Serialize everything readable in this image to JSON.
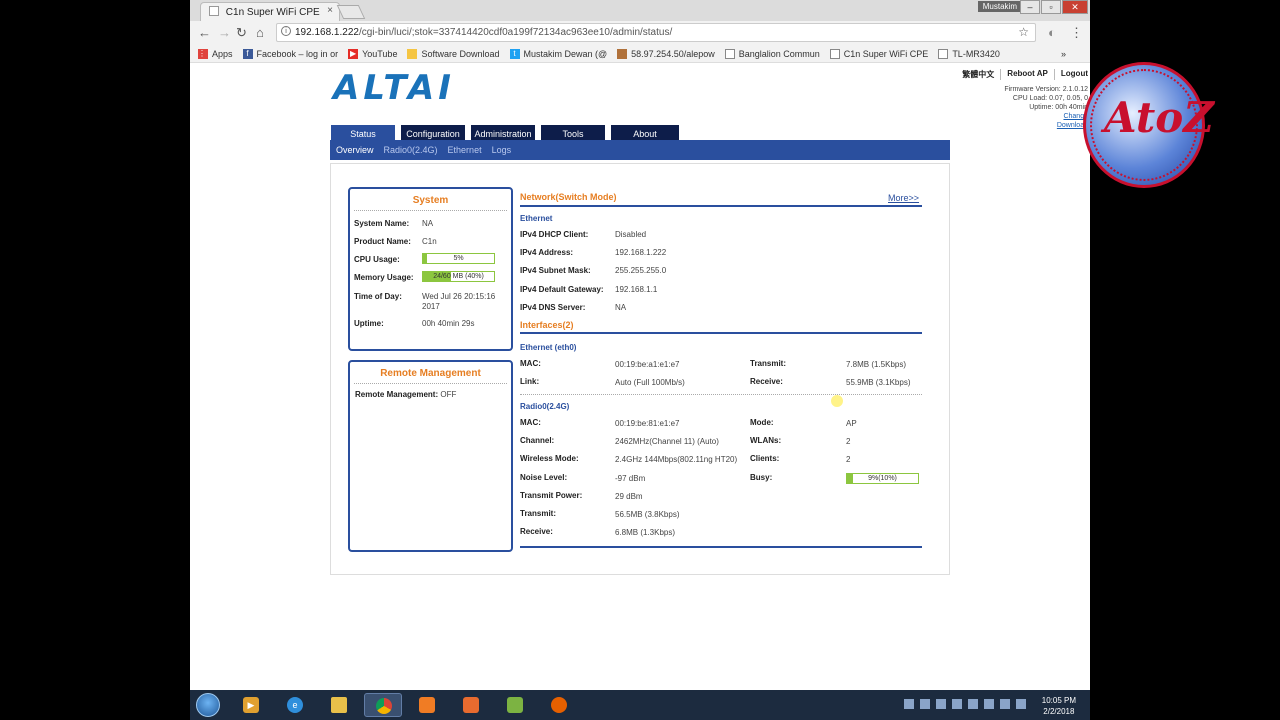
{
  "browser": {
    "tab_title": "C1n Super WiFi CPE",
    "close_glyph": "×",
    "window_user": "Mustakim",
    "url_host": "192.168.1.222",
    "url_path": "/cgi-bin/luci/;stok=337414420cdf0a199f72134ac963ee10/admin/status/",
    "bookmarks": [
      "Apps",
      "Facebook – log in or",
      "YouTube",
      "Software Download",
      "Mustakim Dewan (@",
      "58.97.254.50/alepow",
      "Banglalion Commun",
      "C1n Super WiFi CPE",
      "TL-MR3420"
    ],
    "bookmarks_overflow": "»"
  },
  "header": {
    "logo": "ALTAI",
    "links": [
      "繁體中文",
      "Reboot AP",
      "Logout"
    ],
    "firmware_line": "Firmware Version: 2.1.0.12",
    "cpu_load_line": "CPU Load: 0.07, 0.05, 0",
    "uptime_line": "Uptime: 00h 40min",
    "change_link": "Change",
    "download_link": "Download"
  },
  "nav": {
    "main": [
      "Status",
      "Configuration",
      "Administration",
      "Tools",
      "About"
    ],
    "sub": [
      "Overview",
      "Radio0(2.4G)",
      "Ethernet",
      "Logs"
    ]
  },
  "system": {
    "title": "System",
    "system_name_label": "System Name:",
    "system_name": "NA",
    "product_name_label": "Product Name:",
    "product_name": "C1n",
    "cpu_label": "CPU Usage:",
    "cpu_text": "5%",
    "cpu_fraction": 0.05,
    "memory_label": "Memory Usage:",
    "memory_text": "24/60 MB (40%)",
    "memory_fraction": 0.4,
    "time_label": "Time of Day:",
    "time_line1": "Wed Jul 26 20:15:16",
    "time_line2": "2017",
    "uptime_label": "Uptime:",
    "uptime": "00h 40min 29s"
  },
  "remote": {
    "title": "Remote Management",
    "label": "Remote Management:",
    "value": "OFF"
  },
  "network": {
    "title": "Network(Switch Mode)",
    "more": "More>>",
    "ethernet_title": "Ethernet",
    "dhcp_label": "IPv4 DHCP Client:",
    "dhcp": "Disabled",
    "ip_label": "IPv4 Address:",
    "ip": "192.168.1.222",
    "mask_label": "IPv4 Subnet Mask:",
    "mask": "255.255.255.0",
    "gw_label": "IPv4 Default Gateway:",
    "gw": "192.168.1.1",
    "dns_label": "IPv4 DNS Server:",
    "dns": "NA"
  },
  "interfaces": {
    "title": "Interfaces(2)",
    "eth0": {
      "title": "Ethernet (eth0)",
      "mac_label": "MAC:",
      "mac": "00:19:be:a1:e1:e7",
      "link_label": "Link:",
      "link": "Auto (Full 100Mb/s)",
      "tx_label": "Transmit:",
      "tx": "7.8MB (1.5Kbps)",
      "rx_label": "Receive:",
      "rx": "55.9MB (3.1Kbps)"
    },
    "radio0": {
      "title": "Radio0(2.4G)",
      "mac_label": "MAC:",
      "mac": "00:19:be:81:e1:e7",
      "channel_label": "Channel:",
      "channel": "2462MHz(Channel 11) (Auto)",
      "mode_label": "Wireless Mode:",
      "mode": "2.4GHz 144Mbps(802.11ng HT20)",
      "noise_label": "Noise Level:",
      "noise": "-97 dBm",
      "power_label": "Transmit Power:",
      "power": "29 dBm",
      "tx_label": "Transmit:",
      "tx": "56.5MB (3.8Kbps)",
      "rx_label": "Receive:",
      "rx": "6.8MB (1.3Kbps)",
      "opmode_label": "Mode:",
      "opmode": "AP",
      "wlans_label": "WLANs:",
      "wlans": "2",
      "clients_label": "Clients:",
      "clients": "2",
      "busy_label": "Busy:",
      "busy_text": "9%(10%)",
      "busy_fraction": 0.09
    }
  },
  "taskbar": {
    "time": "10:05 PM",
    "date": "2/2/2018"
  },
  "colors": {
    "brand_blue": "#1a72b9",
    "nav_dark": "#0d1d4a",
    "accent_orange": "#e67e22",
    "bar_green": "#8cc63f"
  }
}
